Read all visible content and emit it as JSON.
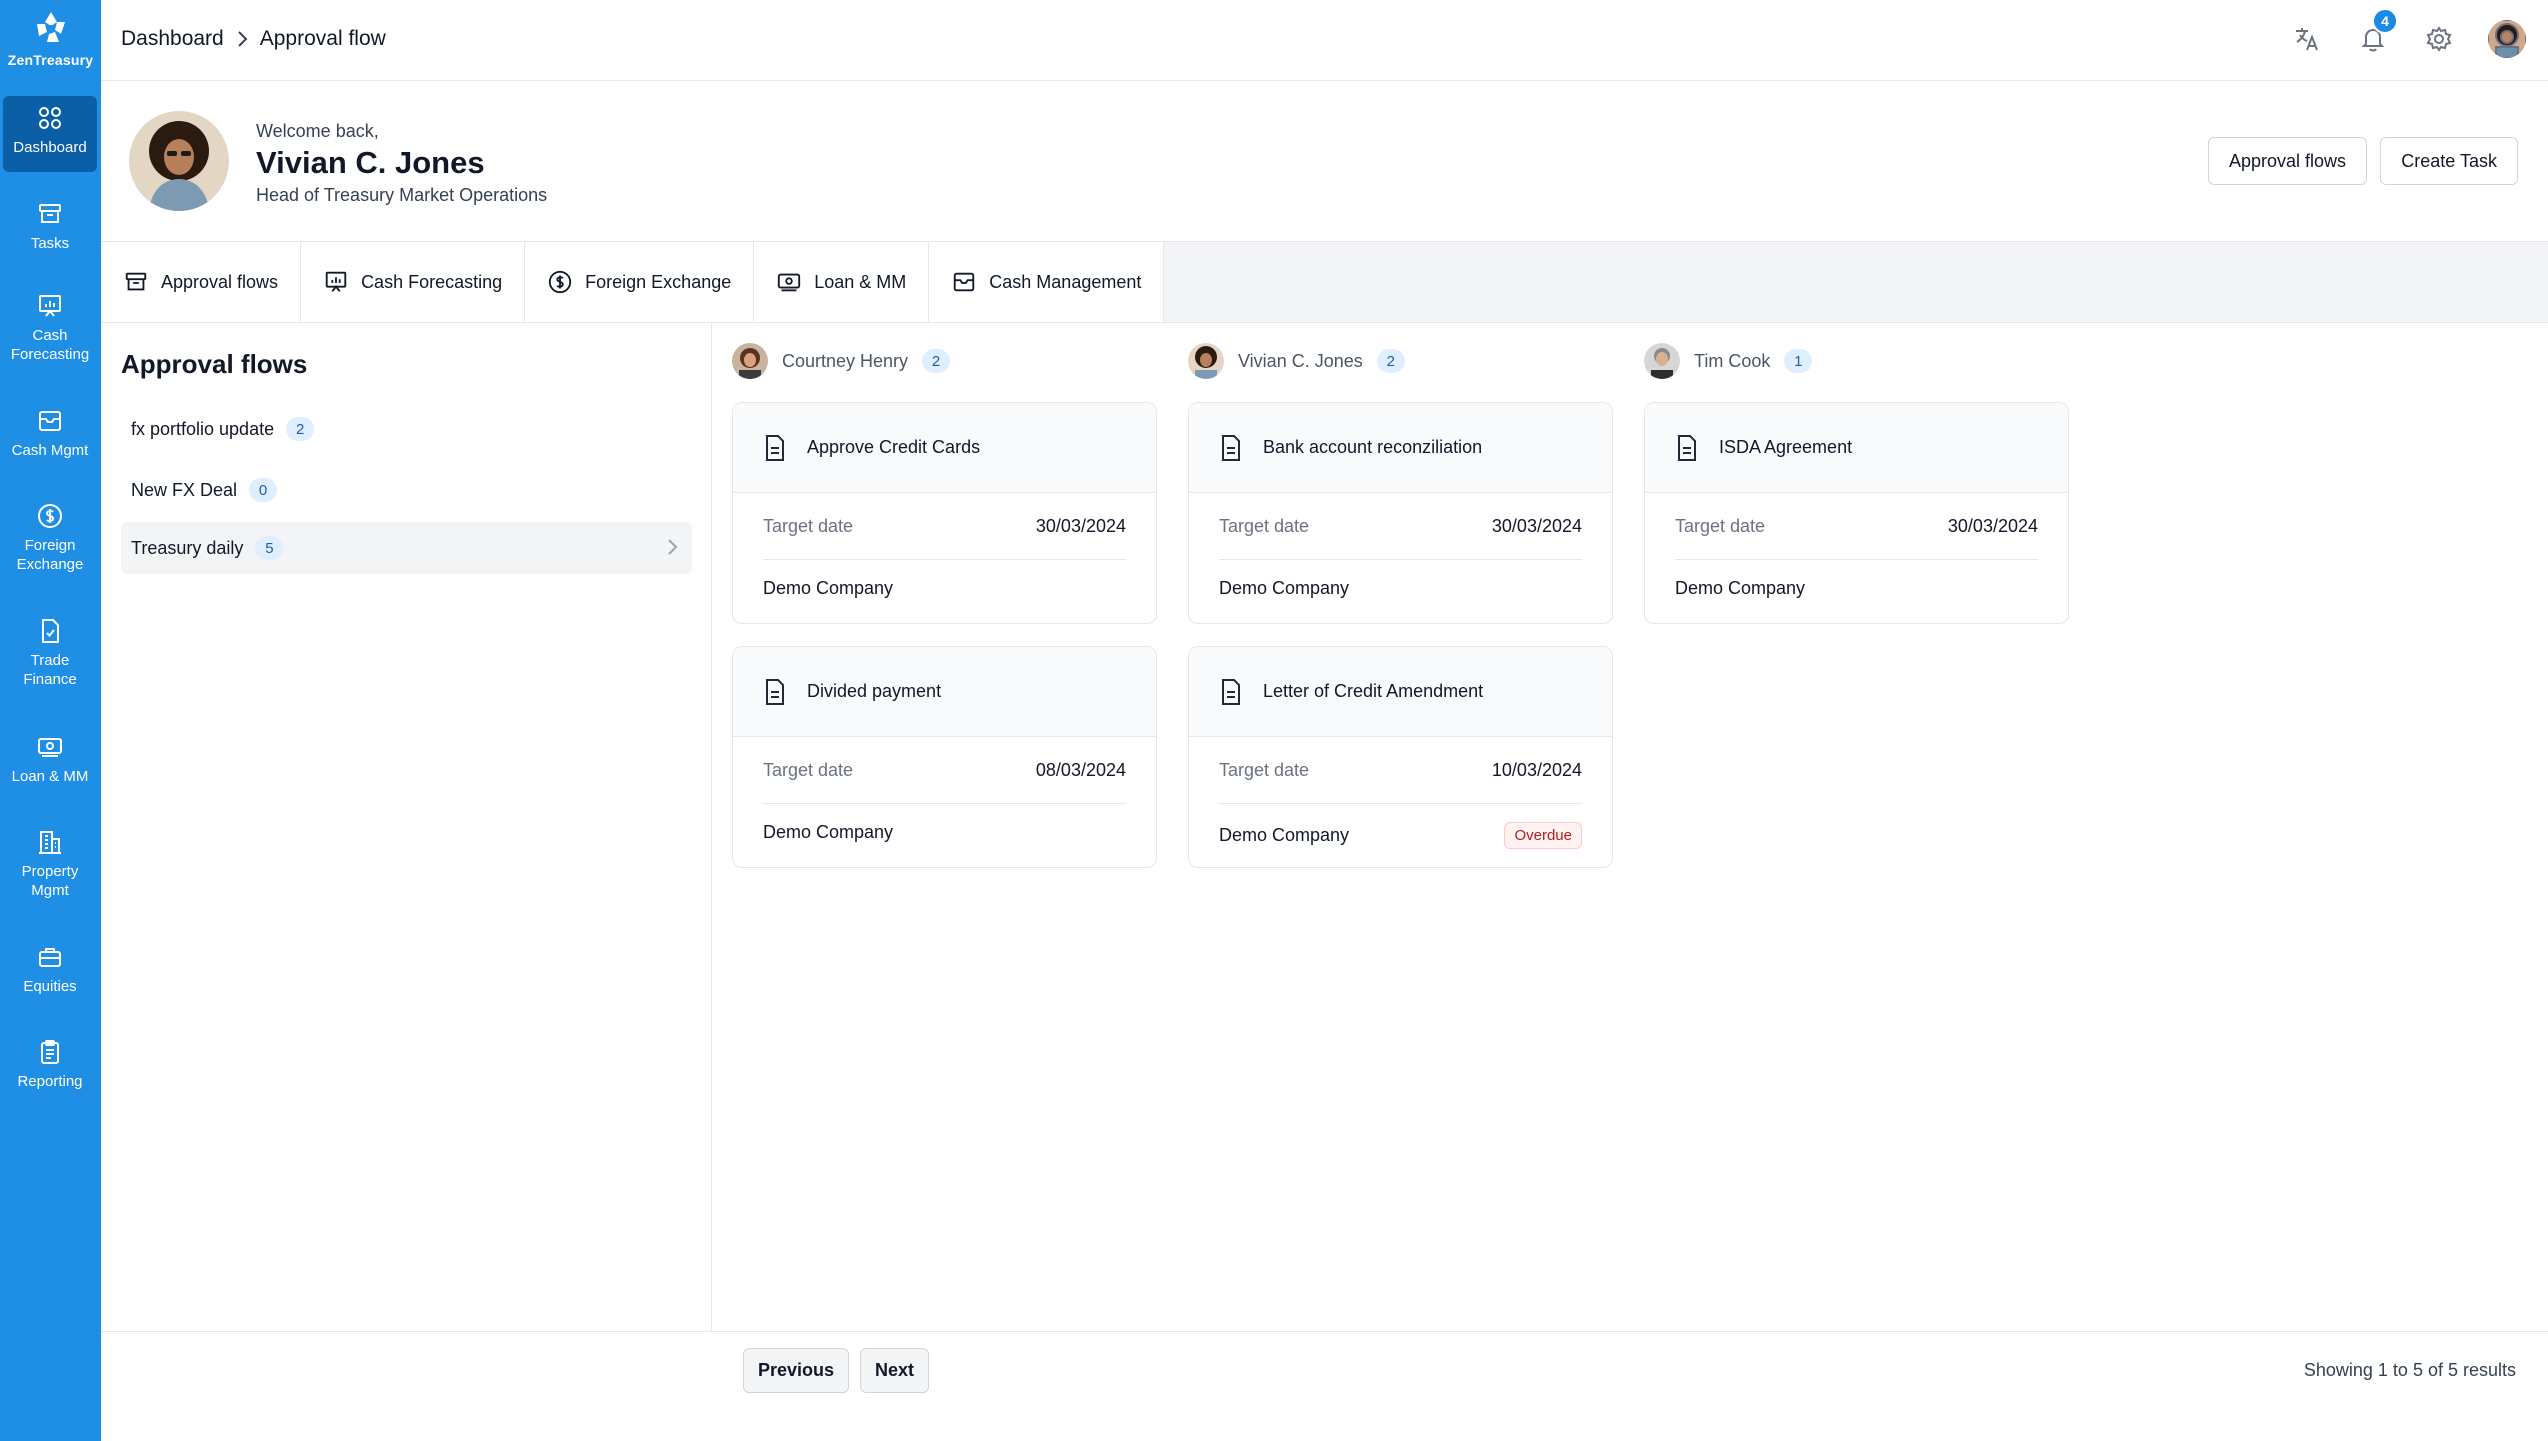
{
  "app": {
    "brand_name": "ZenTreasury",
    "accent": "#1f8fe6"
  },
  "sidebar": {
    "items": [
      {
        "label": "Dashboard",
        "icon": "dashboard-grid-icon",
        "active": true
      },
      {
        "label": "Tasks",
        "icon": "archive-box-icon"
      },
      {
        "label": "Cash Forecasting",
        "icon": "chart-presentation-icon"
      },
      {
        "label": "Cash Mgmt",
        "icon": "cash-tray-icon"
      },
      {
        "label": "Foreign Exchange",
        "icon": "dollar-circle-icon"
      },
      {
        "label": "Trade Finance",
        "icon": "document-check-icon"
      },
      {
        "label": "Loan & MM",
        "icon": "banknote-icon"
      },
      {
        "label": "Property Mgmt",
        "icon": "building-icon"
      },
      {
        "label": "Equities",
        "icon": "briefcase-icon"
      },
      {
        "label": "Reporting",
        "icon": "clipboard-icon"
      }
    ]
  },
  "breadcrumb": {
    "root": "Dashboard",
    "current": "Approval flow"
  },
  "topbar": {
    "notification_count": "4"
  },
  "header": {
    "welcome": "Welcome back,",
    "name": "Vivian C. Jones",
    "role": "Head of Treasury Market Operations",
    "approval_button": "Approval flows",
    "create_button": "Create Task"
  },
  "tabs": [
    {
      "label": "Approval flows",
      "icon": "archive-box-icon"
    },
    {
      "label": "Cash Forecasting",
      "icon": "chart-presentation-icon"
    },
    {
      "label": "Foreign Exchange",
      "icon": "dollar-circle-icon"
    },
    {
      "label": "Loan & MM",
      "icon": "banknote-icon"
    },
    {
      "label": "Cash Management",
      "icon": "cash-tray-icon"
    }
  ],
  "flows": {
    "title": "Approval flows",
    "items": [
      {
        "label": "fx portfolio update",
        "count": "2"
      },
      {
        "label": "New FX Deal",
        "count": "0"
      },
      {
        "label": "Treasury daily",
        "count": "5",
        "selected": true
      }
    ]
  },
  "columns": [
    {
      "name": "Courtney Henry",
      "count": "2",
      "cards": [
        {
          "title": "Approve Credit Cards",
          "date_label": "Target date",
          "date": "30/03/2024",
          "company": "Demo Company"
        },
        {
          "title": "Divided payment",
          "date_label": "Target date",
          "date": "08/03/2024",
          "company": "Demo Company"
        }
      ]
    },
    {
      "name": "Vivian C. Jones",
      "count": "2",
      "cards": [
        {
          "title": "Bank account reconziliation",
          "date_label": "Target date",
          "date": "30/03/2024",
          "company": "Demo Company"
        },
        {
          "title": "Letter of Credit Amendment",
          "date_label": "Target date",
          "date": "10/03/2024",
          "company": "Demo Company",
          "status": "Overdue"
        }
      ]
    },
    {
      "name": "Tim Cook",
      "count": "1",
      "cards": [
        {
          "title": "ISDA Agreement",
          "date_label": "Target date",
          "date": "30/03/2024",
          "company": "Demo Company"
        }
      ]
    }
  ],
  "pagination": {
    "previous": "Previous",
    "next": "Next",
    "summary": "Showing 1 to 5 of 5 results"
  }
}
